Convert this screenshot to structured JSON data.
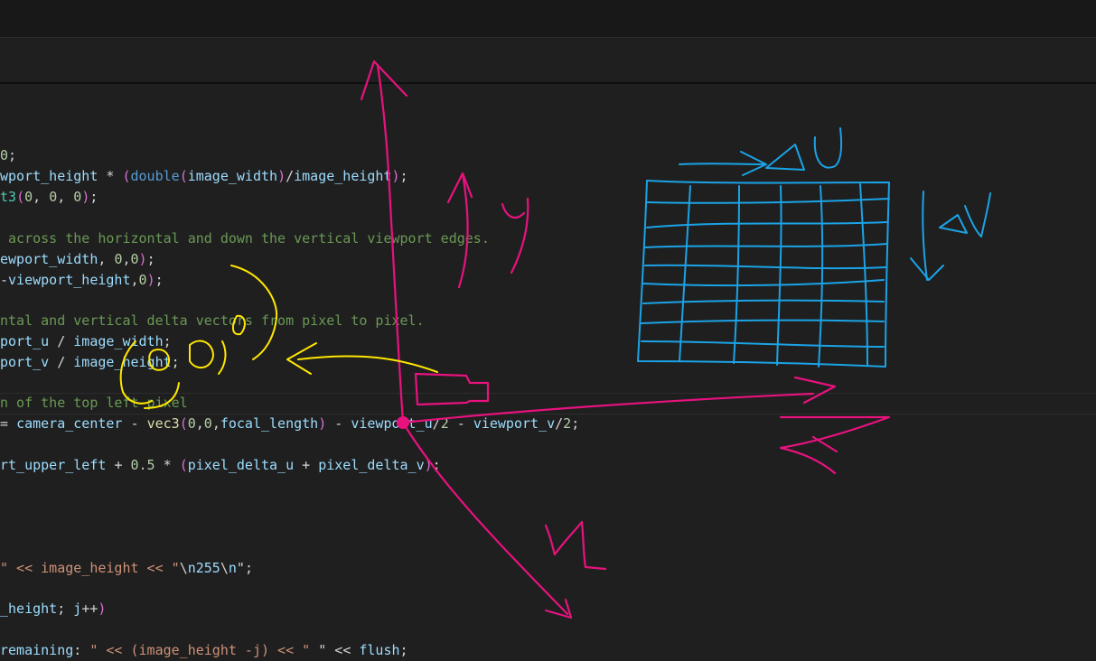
{
  "code_lines": [
    "0;",
    "wport_height * (double(image_width)/image_height);",
    "t3(0, 0, 0);",
    " across the horizontal and down the vertical viewport edges.",
    "ewport_width, 0,0);",
    "-viewport_height,0);",
    "ntal and vertical delta vectors from pixel to pixel.",
    "port_u / image_width;",
    "port_v / image_height;",
    "n of the top left pixel",
    "= camera_center - vec3(0,0,focal_length) - viewport_u/2 - viewport_v/2;",
    "rt_upper_left + 0.5 * (pixel_delta_u + pixel_delta_v);",
    "\" << image_height << \"\\n255\\n\";",
    "_height; j++)",
    "remaining: \" << (image_height -j) << \" \" << flush;"
  ],
  "annotations": {
    "axis_y_label": "y",
    "axis_z_label": "z",
    "grid_u_label": "u",
    "grid_v_label": "v",
    "colors": {
      "axes": "#e8127f",
      "grid": "#1ba3e6",
      "eye": "#ffe600"
    }
  }
}
